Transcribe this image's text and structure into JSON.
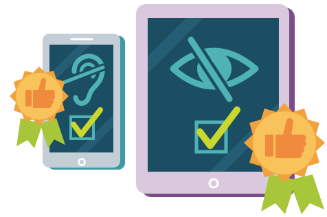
{
  "illustration": {
    "devices": [
      {
        "kind": "phone",
        "screen_icon": "ear-icon",
        "status": "checked"
      },
      {
        "kind": "tablet",
        "screen_icon": "eye-slash-icon",
        "status": "checked"
      }
    ],
    "badges": [
      {
        "icon": "thumbs-up-icon",
        "attached_to": "phone"
      },
      {
        "icon": "thumbs-up-icon",
        "attached_to": "tablet"
      }
    ]
  },
  "colors": {
    "screen": "#1b4e63",
    "screen_stripe": "#245d74",
    "icon": "#4fb3b5",
    "check": "#c9d82a",
    "check_box": "#4fb3b5",
    "phone_body": "#c3ced7",
    "phone_shadow": "#3d9aa3",
    "tablet_body": "#dac8de",
    "tablet_shadow": "#7a4d86",
    "badge_gold": "#f7c35a",
    "badge_edge": "#f2a23c",
    "thumb": "#f08a3c",
    "ribbon": "#a8c63a"
  }
}
